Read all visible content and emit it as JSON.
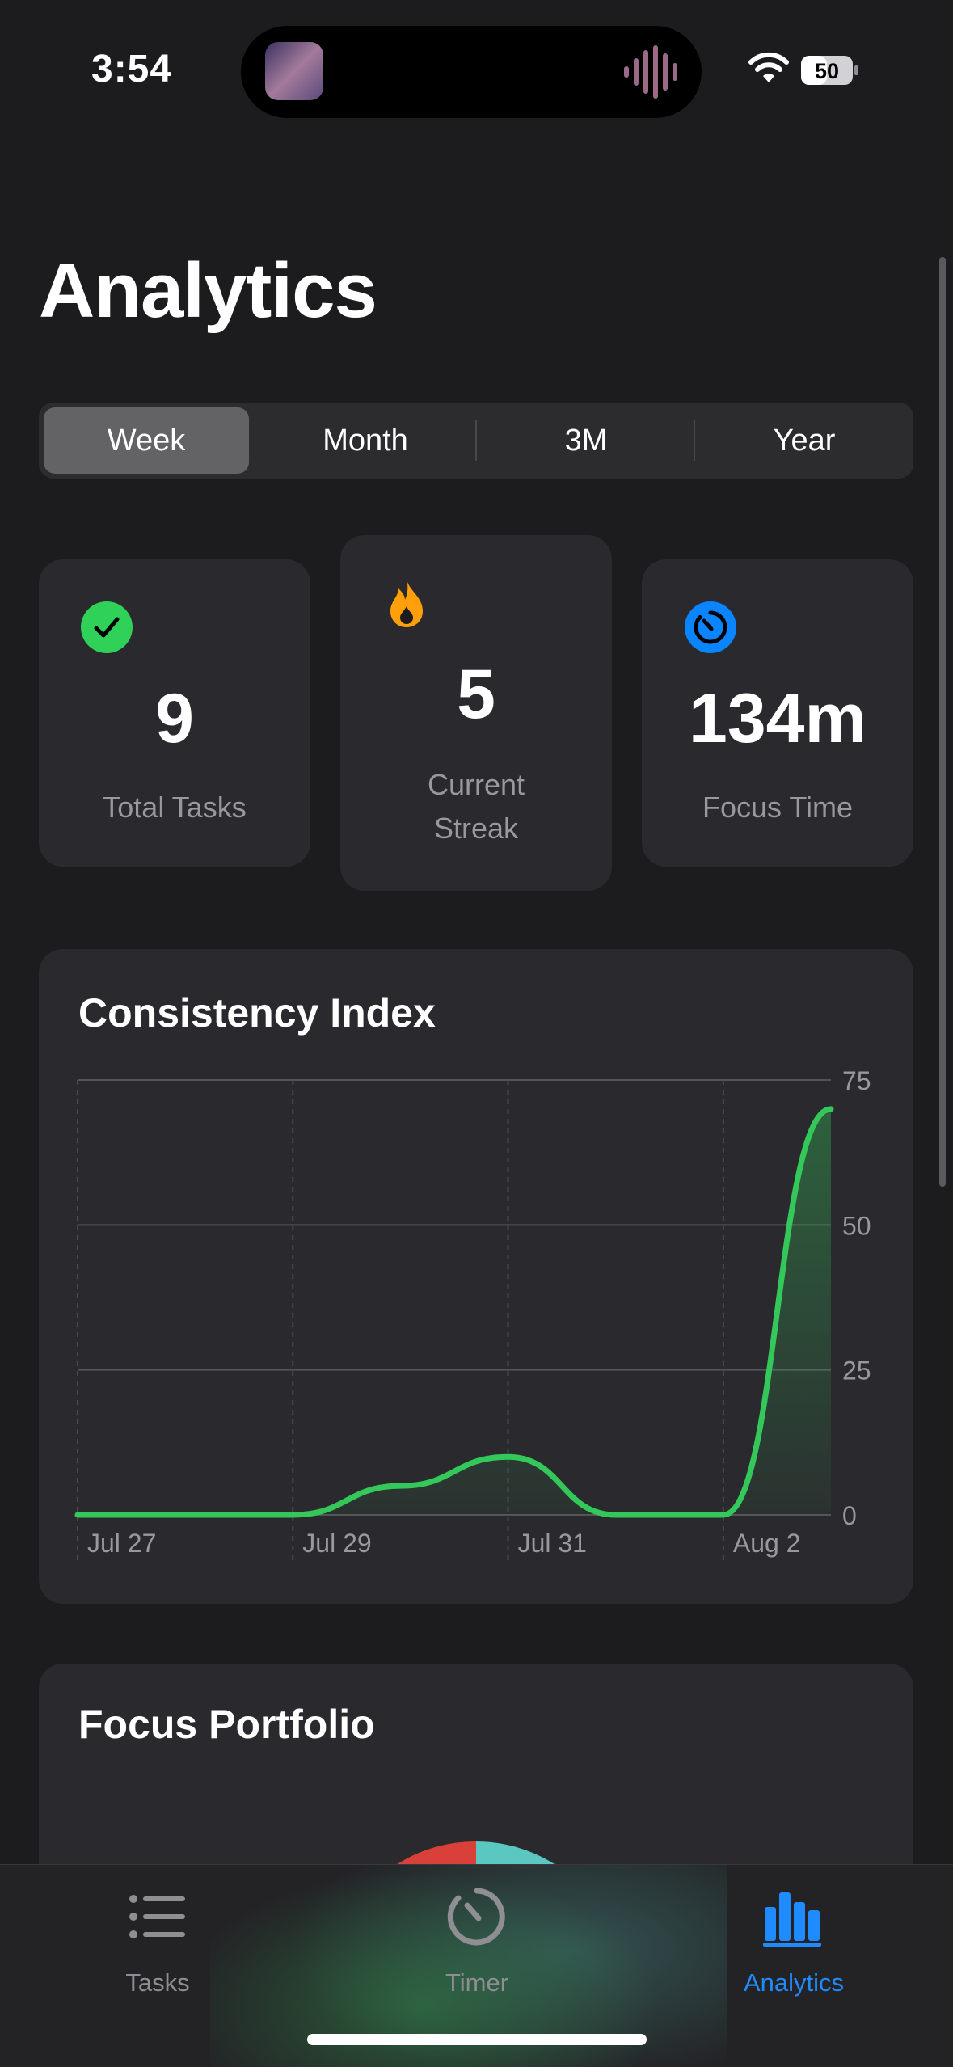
{
  "status_bar": {
    "time": "3:54",
    "battery": "50"
  },
  "page": {
    "title": "Analytics"
  },
  "range_selector": {
    "options": [
      "Week",
      "Month",
      "3M",
      "Year"
    ],
    "selected": "Week"
  },
  "stats": [
    {
      "icon": "checkmark-circle-icon",
      "value": "9",
      "label": "Total Tasks",
      "color": "#30d158"
    },
    {
      "icon": "flame-icon",
      "value": "5",
      "label_lines": [
        "Current",
        "Streak"
      ],
      "color": "#ff9f0a"
    },
    {
      "icon": "timer-icon",
      "value": "134m",
      "label": "Focus Time",
      "color": "#0a84ff"
    }
  ],
  "consistency": {
    "title": "Consistency Index",
    "chart_data": {
      "type": "area",
      "x": [
        "Jul 27",
        "Jul 28",
        "Jul 29",
        "Jul 30",
        "Jul 31",
        "Aug 1",
        "Aug 2",
        "Aug 3"
      ],
      "values": [
        0,
        0,
        0,
        5,
        10,
        0,
        0,
        70
      ],
      "x_tick_labels": [
        "Jul 27",
        "Jul 29",
        "Jul 31",
        "Aug 2"
      ],
      "y_ticks": [
        0,
        25,
        50,
        75
      ],
      "ylim": [
        0,
        75
      ],
      "y_axis_side": "right",
      "grid": true,
      "color": "#34c759"
    }
  },
  "portfolio": {
    "title": "Focus Portfolio",
    "chart_data": {
      "type": "pie",
      "slice_colors": [
        "#5ac8c0",
        "#d9403a",
        "#34c759"
      ]
    }
  },
  "tab_bar": {
    "items": [
      {
        "label": "Tasks",
        "icon": "list-icon",
        "active": false
      },
      {
        "label": "Timer",
        "icon": "timer-gauge-icon",
        "active": false
      },
      {
        "label": "Analytics",
        "icon": "bar-chart-icon",
        "active": true
      }
    ],
    "active_color": "#1f8bff"
  }
}
